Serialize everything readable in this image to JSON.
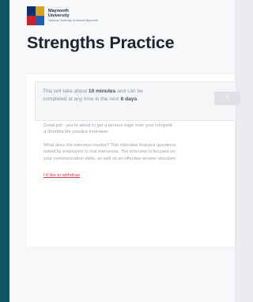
{
  "brand": {
    "name_line1": "Maynooth",
    "name_line2": "University",
    "name_sub": "National University of Ireland Maynooth",
    "colors": [
      "#0b2f6d",
      "#d8a21a",
      "#c7252d",
      "#1c5fb4"
    ]
  },
  "page_title": "Strengths Practice",
  "info": {
    "line1_pre": "This will take about ",
    "duration": "10 minutes",
    "line1_post": " and can be",
    "line2_pre": "completed at any time in the next ",
    "deadline": "6 days",
    "line2_post": ".",
    "start_label": "S"
  },
  "intro": {
    "line1": "Great job - you're about to get a serious edge over your competit",
    "line2": "a Shortlist.Me practice interview!"
  },
  "details": {
    "line1": "What does the interview involve? This interview features questions",
    "line2": "asked by employers in real interviews. The interview is focused on",
    "line3": "your communication skills, as well as an effective answer structure"
  },
  "withdraw_label": "I'd like to withdraw",
  "accent_color": "#0e5566",
  "link_color": "#d0414a"
}
